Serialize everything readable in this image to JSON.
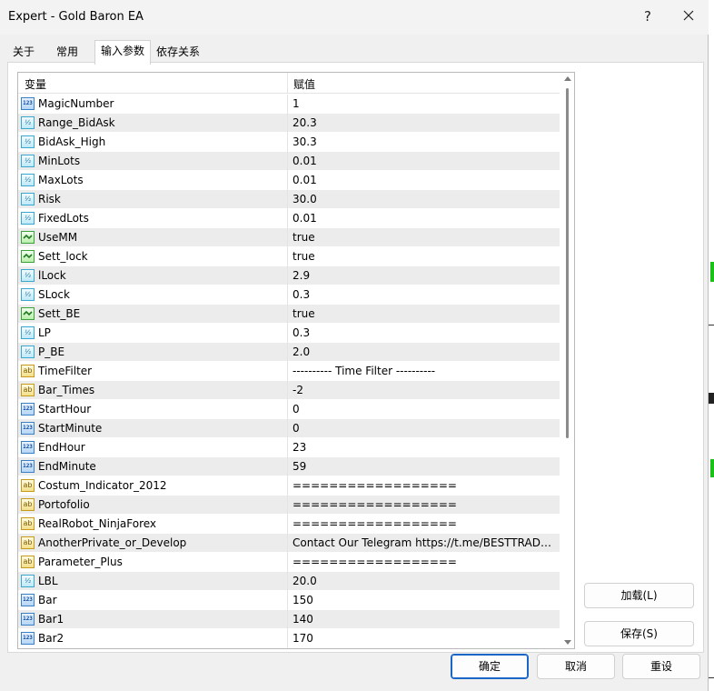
{
  "window": {
    "title": "Expert - Gold Baron EA",
    "help_label": "?"
  },
  "tabs": [
    {
      "label": "关于"
    },
    {
      "label": "常用"
    },
    {
      "label": "输入参数"
    },
    {
      "label": "依存关系"
    }
  ],
  "table": {
    "col_variable": "变量",
    "col_value": "赋值",
    "rows": [
      {
        "name": "MagicNumber",
        "value": "1",
        "type": "int"
      },
      {
        "name": "Range_BidAsk",
        "value": "20.3",
        "type": "double"
      },
      {
        "name": "BidAsk_High",
        "value": "30.3",
        "type": "double"
      },
      {
        "name": "MinLots",
        "value": "0.01",
        "type": "double"
      },
      {
        "name": "MaxLots",
        "value": "0.01",
        "type": "double"
      },
      {
        "name": "Risk",
        "value": "30.0",
        "type": "double"
      },
      {
        "name": "FixedLots",
        "value": "0.01",
        "type": "double"
      },
      {
        "name": "UseMM",
        "value": "true",
        "type": "bool"
      },
      {
        "name": "Sett_lock",
        "value": "true",
        "type": "bool"
      },
      {
        "name": "lLock",
        "value": "2.9",
        "type": "double"
      },
      {
        "name": "SLock",
        "value": "0.3",
        "type": "double"
      },
      {
        "name": "Sett_BE",
        "value": "true",
        "type": "bool"
      },
      {
        "name": "LP",
        "value": "0.3",
        "type": "double"
      },
      {
        "name": "P_BE",
        "value": "2.0",
        "type": "double"
      },
      {
        "name": "TimeFilter",
        "value": "---------- Time Filter ----------",
        "type": "string"
      },
      {
        "name": "Bar_Times",
        "value": "-2",
        "type": "string"
      },
      {
        "name": "StartHour",
        "value": "0",
        "type": "int"
      },
      {
        "name": "StartMinute",
        "value": "0",
        "type": "int"
      },
      {
        "name": "EndHour",
        "value": "23",
        "type": "int"
      },
      {
        "name": "EndMinute",
        "value": "59",
        "type": "int"
      },
      {
        "name": "Costum_Indicator_2012",
        "value": "==================",
        "type": "string"
      },
      {
        "name": "Portofolio",
        "value": "==================",
        "type": "string"
      },
      {
        "name": "RealRobot_NinjaForex",
        "value": "==================",
        "type": "string"
      },
      {
        "name": "AnotherPrivate_or_Develop",
        "value": "Contact Our Telegram https://t.me/BESTTRADER...",
        "type": "string"
      },
      {
        "name": "Parameter_Plus",
        "value": "==================",
        "type": "string"
      },
      {
        "name": "LBL",
        "value": "20.0",
        "type": "double"
      },
      {
        "name": "Bar",
        "value": "150",
        "type": "int"
      },
      {
        "name": "Bar1",
        "value": "140",
        "type": "int"
      },
      {
        "name": "Bar2",
        "value": "170",
        "type": "int"
      }
    ]
  },
  "icons": {
    "int": "123",
    "double": "½",
    "string": "ab"
  },
  "buttons": {
    "load": "加载(L)",
    "save": "保存(S)",
    "ok": "确定",
    "cancel": "取消",
    "reset": "重设"
  },
  "colors": {
    "accent": "#1a66c7",
    "alt_row": "#ececec"
  }
}
